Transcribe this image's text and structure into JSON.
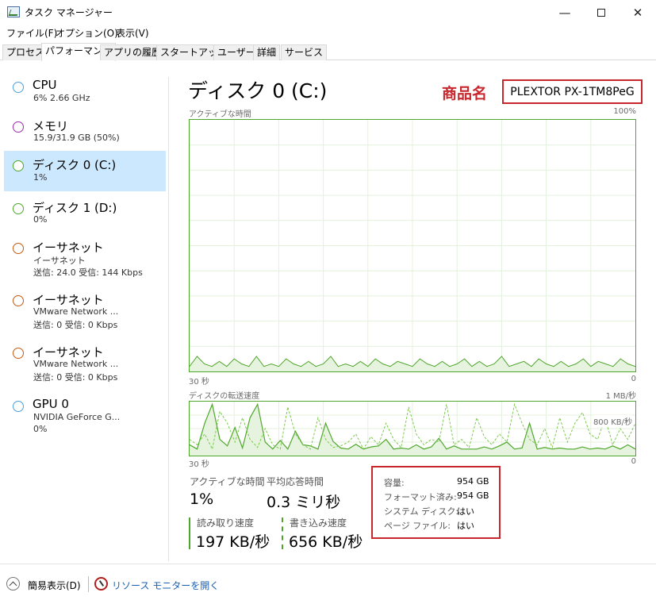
{
  "window": {
    "title": "タスク マネージャー",
    "minimize": "—",
    "close": "✕"
  },
  "menu": [
    "ファイル(F)",
    "オプション(O)",
    "表示(V)"
  ],
  "tabs": [
    "プロセス",
    "パフォーマンス",
    "アプリの履歴",
    "スタートアップ",
    "ユーザー",
    "詳細",
    "サービス"
  ],
  "active_tab": "パフォーマンス",
  "sidebar": {
    "items": [
      {
        "title": "CPU",
        "sub1": "6%  2.66 GHz",
        "sub2": "",
        "color": "#4aa0df"
      },
      {
        "title": "メモリ",
        "sub1": "15.9/31.9 GB (50%)",
        "sub2": "",
        "color": "#9b2bad"
      },
      {
        "title": "ディスク 0 (C:)",
        "sub1": "1%",
        "sub2": "",
        "color": "#4ea72a"
      },
      {
        "title": "ディスク 1 (D:)",
        "sub1": "0%",
        "sub2": "",
        "color": "#4ea72a"
      },
      {
        "title": "イーサネット",
        "sub1": "イーサネット",
        "sub2": "送信: 24.0 受信: 144 Kbps",
        "color": "#c55a11"
      },
      {
        "title": "イーサネット",
        "sub1": "VMware Network ...",
        "sub2": "送信: 0 受信: 0 Kbps",
        "color": "#c55a11"
      },
      {
        "title": "イーサネット",
        "sub1": "VMware Network ...",
        "sub2": "送信: 0 受信: 0 Kbps",
        "color": "#c55a11"
      },
      {
        "title": "GPU 0",
        "sub1": "NVIDIA GeForce G...",
        "sub2": "0%",
        "color": "#4aa0df"
      }
    ],
    "selected_index": 2
  },
  "main": {
    "disk_title": "ディスク 0 (C:)",
    "model_label": "商品名",
    "model_name": "PLEXTOR PX-1TM8PeG",
    "active_time_chart": {
      "label": "アクティブな時間",
      "max_label": "100%",
      "time_label": "30 秒",
      "min_label": "0"
    },
    "transfer_chart": {
      "label": "ディスクの転送速度",
      "max_label": "1 MB/秒",
      "mid_label": "800 KB/秒",
      "time_label": "30 秒",
      "min_label": "0"
    },
    "stats": {
      "active_time_label": "アクティブな時間",
      "active_time_value": "1%",
      "response_label": "平均応答時間",
      "response_value": "0.3 ミリ秒",
      "read_label": "読み取り速度",
      "read_value": "197 KB/秒",
      "write_label": "書き込み速度",
      "write_value": "656 KB/秒"
    },
    "info": [
      {
        "key": "容量:",
        "value": "954 GB"
      },
      {
        "key": "フォーマット済み:",
        "value": "954 GB"
      },
      {
        "key": "システム ディスク:",
        "value": "はい"
      },
      {
        "key": "ページ ファイル:",
        "value": "はい"
      }
    ]
  },
  "footer": {
    "fewer_details": "簡易表示(D)",
    "resource_monitor": "リソース モニターを開く"
  },
  "chart_data": [
    {
      "type": "area",
      "title": "アクティブな時間",
      "xlabel": "30 秒",
      "ylim": [
        0,
        100
      ],
      "series": [
        {
          "values": [
            2,
            6,
            3,
            2,
            4,
            2,
            5,
            3,
            2,
            6,
            2,
            3,
            2,
            5,
            3,
            2,
            4,
            2,
            3,
            6,
            2,
            3,
            2,
            4,
            2,
            5,
            3,
            2,
            4,
            3,
            2,
            5,
            3,
            2,
            4,
            2,
            3,
            5,
            2,
            4,
            2,
            3,
            6,
            2,
            3,
            4,
            2,
            5,
            3,
            2,
            4,
            2,
            3,
            5,
            2,
            4,
            3,
            2,
            5,
            3,
            2
          ]
        }
      ]
    },
    {
      "type": "line",
      "title": "ディスクの転送速度",
      "xlabel": "30 秒",
      "ylim": [
        0,
        1000
      ],
      "series": [
        {
          "name": "読み取り速度",
          "values": [
            200,
            120,
            600,
            950,
            300,
            180,
            520,
            140,
            700,
            950,
            250,
            120,
            280,
            120,
            450,
            200,
            180,
            120,
            600,
            260,
            140,
            120,
            210,
            120,
            160,
            180,
            300,
            120,
            140,
            120,
            200,
            120,
            160,
            320,
            120,
            180,
            120,
            120,
            120,
            160,
            120,
            180,
            250,
            120,
            140,
            600,
            120,
            150,
            120,
            140,
            120,
            120,
            160,
            120,
            140,
            120,
            180,
            120,
            200,
            120
          ]
        },
        {
          "name": "書き込み速度",
          "values": [
            300,
            200,
            400,
            120,
            820,
            600,
            250,
            700,
            300,
            150,
            500,
            200,
            120,
            900,
            400,
            200,
            120,
            700,
            300,
            150,
            180,
            250,
            400,
            120,
            350,
            200,
            600,
            300,
            150,
            900,
            400,
            200,
            300,
            250,
            950,
            200,
            300,
            150,
            700,
            350,
            200,
            400,
            250,
            950,
            600,
            300,
            200,
            500,
            150,
            700,
            250,
            600,
            800,
            400,
            300,
            700,
            200,
            500,
            300,
            600
          ]
        }
      ]
    }
  ]
}
